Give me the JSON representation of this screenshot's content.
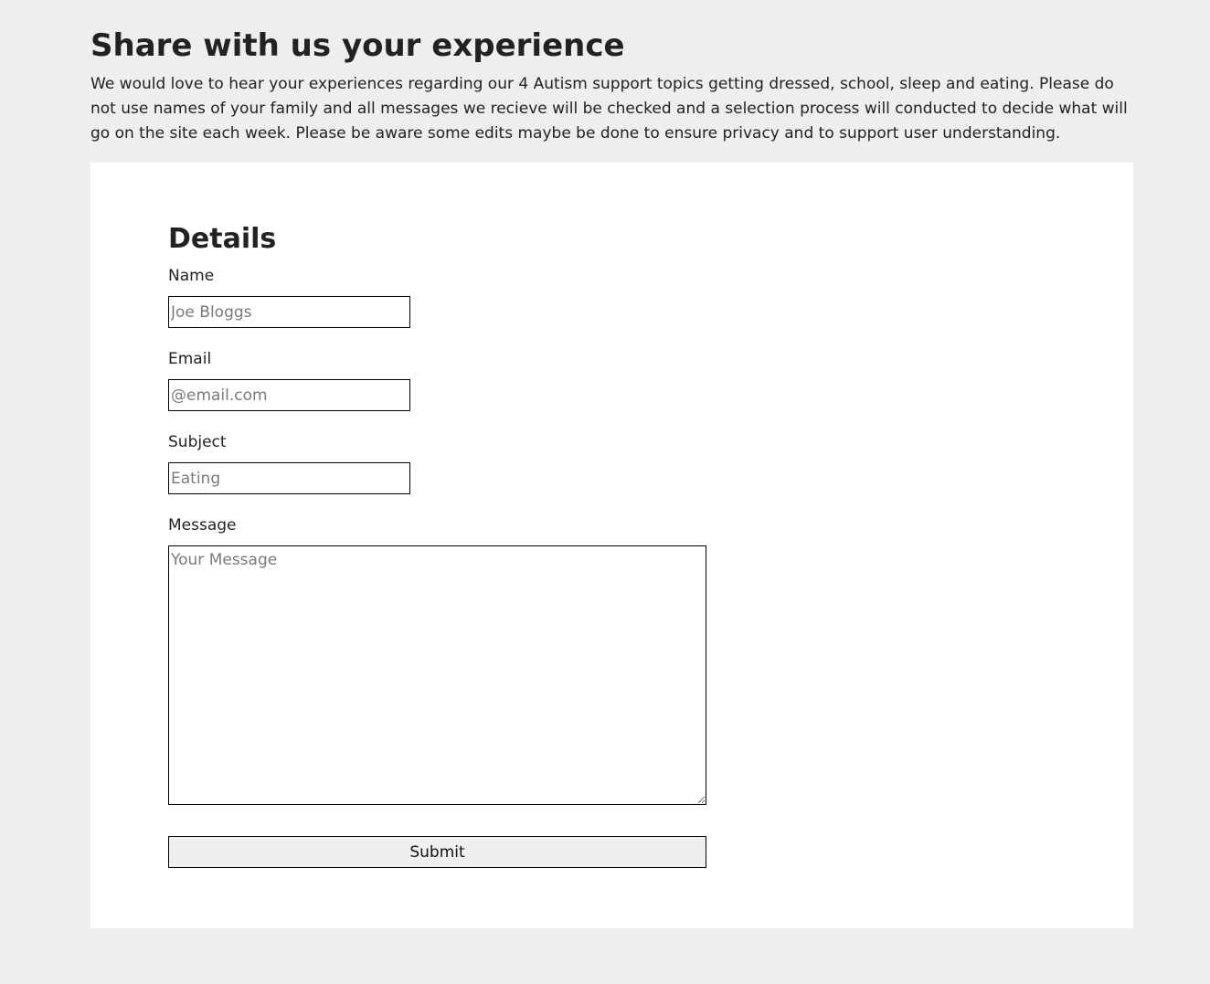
{
  "page": {
    "title": "Share with us your experience",
    "intro": "We would love to hear your experiences regarding our 4 Autism support topics getting dressed, school, sleep and eating. Please do not use names of your family and all messages we recieve will be checked and a selection process will conducted to decide what will go on the site each week. Please be aware some edits maybe be done to ensure privacy and to support user understanding."
  },
  "form": {
    "section_title": "Details",
    "name": {
      "label": "Name",
      "placeholder": "Joe Bloggs",
      "value": ""
    },
    "email": {
      "label": "Email",
      "placeholder": "@email.com",
      "value": ""
    },
    "subject": {
      "label": "Subject",
      "placeholder": "Eating",
      "value": ""
    },
    "message": {
      "label": "Message",
      "placeholder": "Your Message",
      "value": ""
    },
    "submit_label": "Submit"
  },
  "colors": {
    "page_background": "#eeeeee",
    "card_background": "#ffffff",
    "text": "#222222",
    "border": "#000000",
    "button_background": "#efefef"
  }
}
